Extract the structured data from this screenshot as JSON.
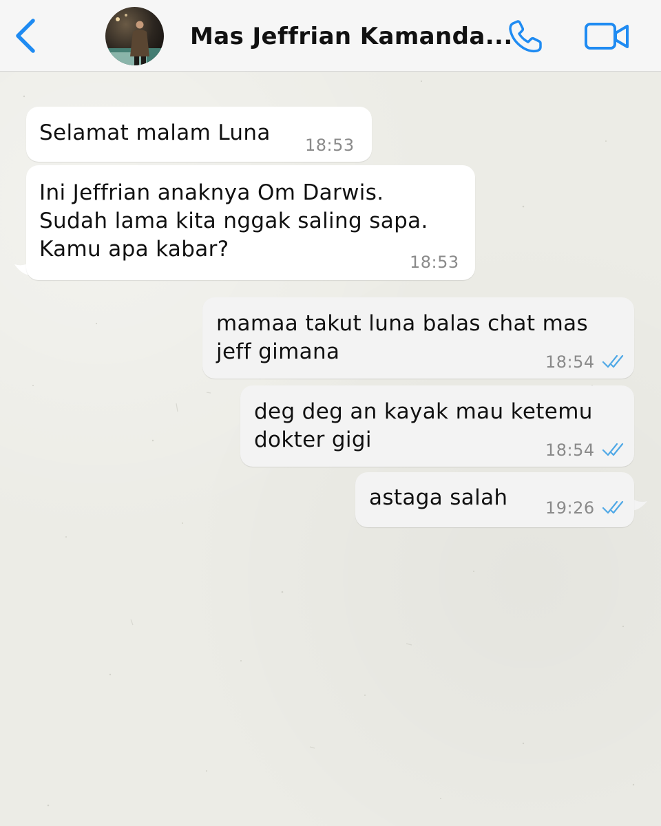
{
  "header": {
    "contact_name": "Mas Jeffrian Kamanda...",
    "icons": {
      "back": "chevron-left-icon",
      "call": "phone-icon",
      "video": "video-camera-icon"
    },
    "accent_color": "#1f8bf2"
  },
  "messages": [
    {
      "direction": "incoming",
      "text": "Selamat malam Luna",
      "time": "18:53"
    },
    {
      "direction": "incoming",
      "text": "Ini Jeffrian anaknya Om Darwis.\nSudah lama kita nggak saling sapa.\nKamu apa kabar?",
      "time": "18:53"
    },
    {
      "direction": "outgoing",
      "text": "mamaa takut luna balas chat mas\njeff gimana",
      "time": "18:54",
      "status": "read"
    },
    {
      "direction": "outgoing",
      "text": "deg deg an kayak mau ketemu\ndokter gigi",
      "time": "18:54",
      "status": "read"
    },
    {
      "direction": "outgoing",
      "text": "astaga salah",
      "time": "19:26",
      "status": "read"
    }
  ],
  "colors": {
    "read_ticks": "#4fa8e6",
    "incoming_bubble": "#ffffff",
    "outgoing_bubble": "#f3f3f3"
  }
}
